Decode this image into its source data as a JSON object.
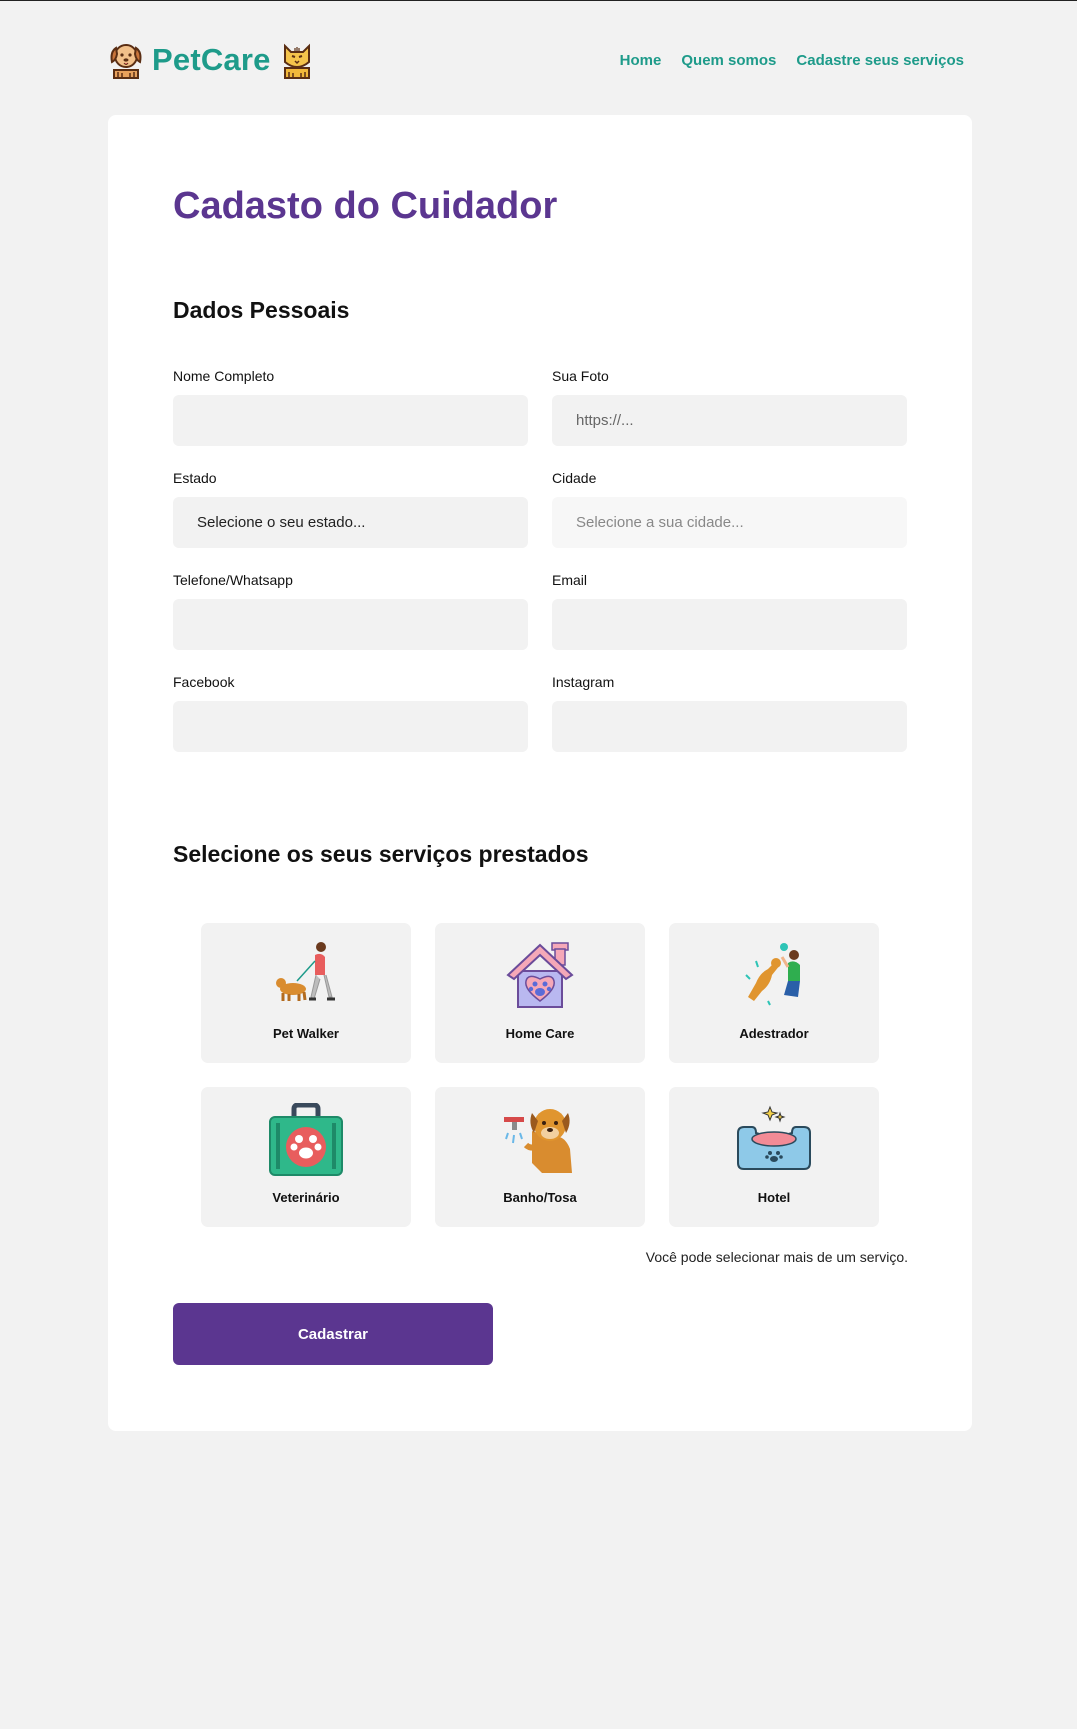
{
  "brand": {
    "name": "PetCare",
    "color": "#1e9b8a"
  },
  "nav": [
    {
      "label": "Home"
    },
    {
      "label": "Quem somos"
    },
    {
      "label": "Cadastre seus serviços"
    }
  ],
  "form": {
    "title": "Cadasto do Cuidador",
    "title_color": "#5b3690",
    "personal_section": "Dados Pessoais",
    "fields": {
      "nome": {
        "label": "Nome Completo",
        "value": ""
      },
      "foto": {
        "label": "Sua Foto",
        "placeholder": "https://..."
      },
      "estado": {
        "label": "Estado",
        "value": "Selecione o seu estado..."
      },
      "cidade": {
        "label": "Cidade",
        "value": "Selecione a sua cidade..."
      },
      "telefone": {
        "label": "Telefone/Whatsapp",
        "value": ""
      },
      "email": {
        "label": "Email",
        "value": ""
      },
      "facebook": {
        "label": "Facebook",
        "value": ""
      },
      "instagram": {
        "label": "Instagram",
        "value": ""
      }
    },
    "services_section": "Selecione os seus serviços prestados",
    "services": [
      {
        "label": "Pet Walker",
        "icon": "dog-walker-icon"
      },
      {
        "label": "Home Care",
        "icon": "pet-house-icon"
      },
      {
        "label": "Adestrador",
        "icon": "dog-trainer-icon"
      },
      {
        "label": "Veterinário",
        "icon": "vet-kit-icon"
      },
      {
        "label": "Banho/Tosa",
        "icon": "dog-bath-icon"
      },
      {
        "label": "Hotel",
        "icon": "pet-bed-icon"
      }
    ],
    "services_hint": "Você pode selecionar mais de um serviço.",
    "submit_label": "Cadastrar",
    "submit_color": "#5b3690"
  }
}
